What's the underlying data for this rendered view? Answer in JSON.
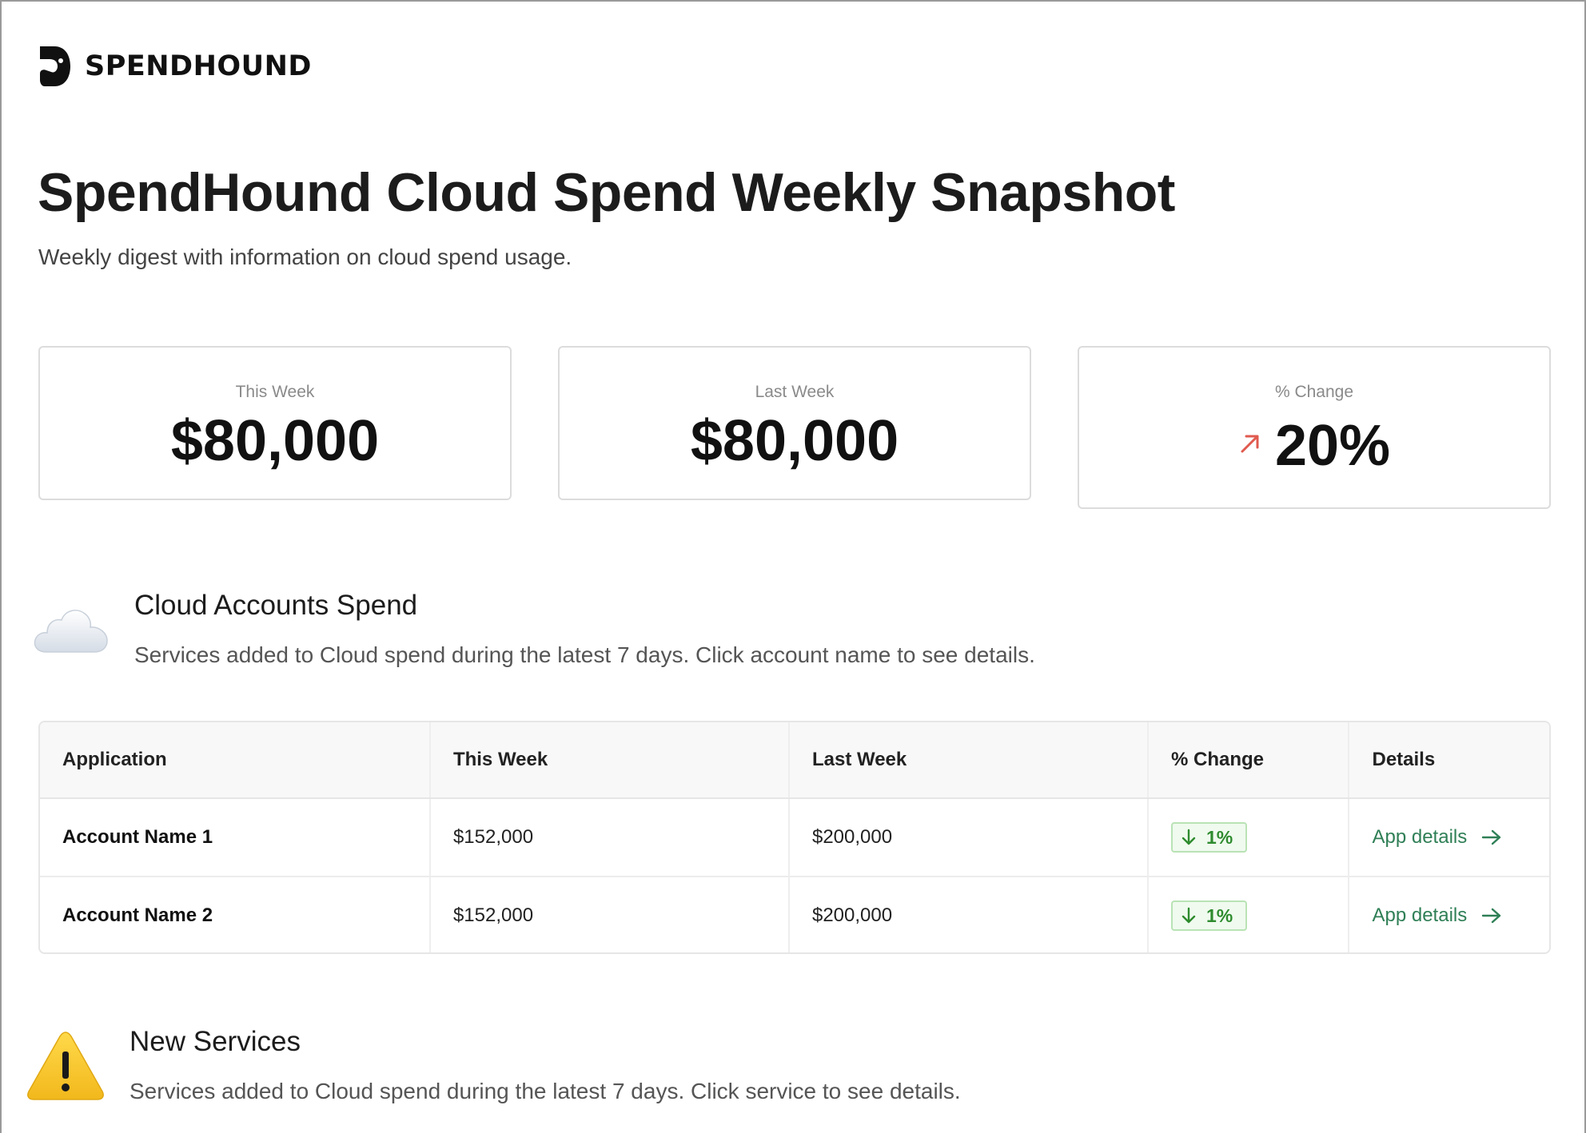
{
  "brand": {
    "name": "SPENDHOUND"
  },
  "header": {
    "title": "SpendHound Cloud Spend Weekly Snapshot",
    "subtitle": "Weekly digest with information on cloud spend usage."
  },
  "stats": [
    {
      "label": "This Week",
      "value": "$80,000"
    },
    {
      "label": "Last Week",
      "value": "$80,000"
    },
    {
      "label": "% Change",
      "value": "20%",
      "trend": "up",
      "trend_color": "#e05a4f"
    }
  ],
  "cloud_section": {
    "icon": "cloud-icon",
    "title": "Cloud Accounts Spend",
    "description": "Services added to Cloud spend during the latest 7 days. Click account name to see details."
  },
  "table": {
    "columns": [
      "Application",
      "This Week",
      "Last Week",
      "% Change",
      "Details"
    ],
    "rows": [
      {
        "name": "Account Name 1",
        "this_week": "$152,000",
        "last_week": "$200,000",
        "change": "1%",
        "change_direction": "down",
        "details_label": "App details"
      },
      {
        "name": "Account Name 2",
        "this_week": "$152,000",
        "last_week": "$200,000",
        "change": "1%",
        "change_direction": "down",
        "details_label": "App details"
      }
    ]
  },
  "services_section": {
    "icon": "warning-icon",
    "title": "New Services",
    "description": "Services added to Cloud spend during the latest 7 days. Click service to see details."
  },
  "colors": {
    "link": "#2f7f56",
    "badge_text": "#2e8b2e",
    "badge_border": "#b9e3b5",
    "trend_up": "#e05a4f"
  }
}
